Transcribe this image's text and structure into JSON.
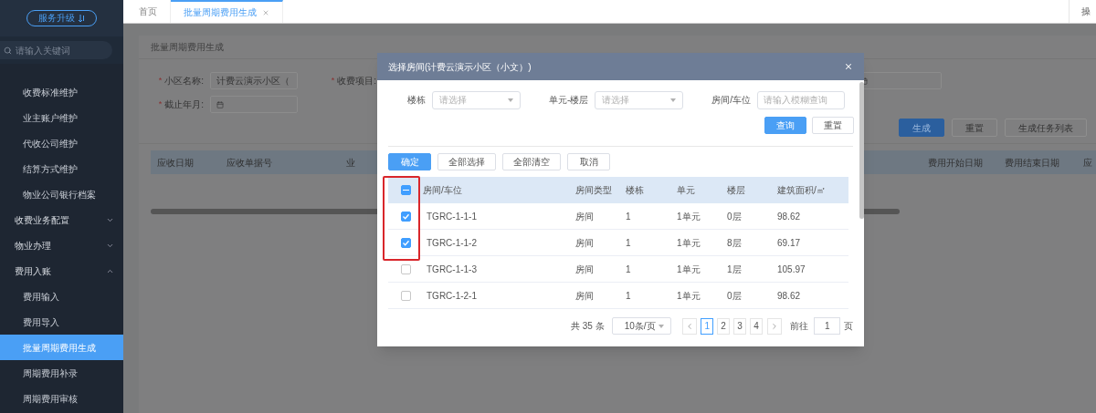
{
  "sidebar": {
    "upgrade_button": "服务升级",
    "search": {
      "placeholder": "请输入关键词"
    },
    "items": [
      {
        "label": "收费标准维护",
        "selected": false
      },
      {
        "label": "业主账户维护",
        "selected": false
      },
      {
        "label": "代收公司维护",
        "selected": false
      },
      {
        "label": "结算方式维护",
        "selected": false
      },
      {
        "label": "物业公司银行档案",
        "selected": false
      }
    ],
    "groups": [
      {
        "label": "收费业务配置",
        "expanded": false
      },
      {
        "label": "物业办理",
        "expanded": false
      },
      {
        "label": "费用入账",
        "expanded": true,
        "children": [
          {
            "label": "费用输入",
            "selected": false
          },
          {
            "label": "费用导入",
            "selected": false
          },
          {
            "label": "批量周期费用生成",
            "selected": true
          },
          {
            "label": "周期费用补录",
            "selected": false
          },
          {
            "label": "周期费用审核",
            "selected": false
          }
        ]
      }
    ]
  },
  "top_bar": {
    "tabs": [
      {
        "label": "首页",
        "selected": false,
        "closable": false
      },
      {
        "label": "批量周期费用生成",
        "selected": true,
        "closable": true
      }
    ],
    "right_label": "操"
  },
  "page": {
    "title": "批量周期费用生成",
    "form_rows": [
      [
        {
          "kind": "text",
          "required_mark": "*",
          "label": "小区名称:",
          "value": "计费云演示小区（"
        },
        {
          "kind": "label_only",
          "required_mark": "*",
          "label": "收费项目:"
        },
        {
          "kind": "date"
        }
      ],
      [
        {
          "kind": "date",
          "required_mark": "*",
          "label": "截止年月:"
        }
      ]
    ],
    "buttons": [
      {
        "label": "生成",
        "primary": true
      },
      {
        "label": "重置",
        "primary": false
      },
      {
        "label": "生成任务列表",
        "primary": false
      }
    ],
    "table": {
      "columns_left": [
        "应收日期",
        "应收单据号",
        "业"
      ],
      "columns_right": [
        "费用开始日期",
        "费用结束日期",
        "应"
      ]
    }
  },
  "modal": {
    "title": "选择房间(计费云演示小区（小文）)",
    "filters": [
      {
        "kind": "select",
        "label": "楼栋",
        "placeholder": "请选择"
      },
      {
        "kind": "select",
        "label": "单元-楼层",
        "placeholder": "请选择"
      },
      {
        "kind": "input",
        "label": "房间/车位",
        "placeholder": "请输入模糊查询"
      }
    ],
    "filter_buttons": [
      {
        "label": "查询",
        "primary": true
      },
      {
        "label": "重置",
        "primary": false
      }
    ],
    "actions": [
      {
        "label": "确定",
        "primary": true
      },
      {
        "label": "全部选择",
        "primary": false
      },
      {
        "label": "全部清空",
        "primary": false
      },
      {
        "label": "取消",
        "primary": false
      }
    ],
    "header_checked": true,
    "header_indeterminate": true,
    "columns": [
      "房间/车位",
      "房间类型",
      "楼栋",
      "单元",
      "楼层",
      "建筑面积/㎡"
    ],
    "rows": [
      {
        "checked": true,
        "cells": [
          "TGRC-1-1-1",
          "房间",
          "1",
          "1单元",
          "0层",
          "98.62"
        ]
      },
      {
        "checked": true,
        "cells": [
          "TGRC-1-1-2",
          "房间",
          "1",
          "1单元",
          "8层",
          "69.17"
        ]
      },
      {
        "checked": false,
        "cells": [
          "TGRC-1-1-3",
          "房间",
          "1",
          "1单元",
          "1层",
          "105.97"
        ]
      },
      {
        "checked": false,
        "cells": [
          "TGRC-1-2-1",
          "房间",
          "1",
          "1单元",
          "0层",
          "98.62"
        ]
      }
    ],
    "pagination": {
      "total": "共 35 条",
      "page_size": "10条/页",
      "pages": [
        {
          "label": "1",
          "selected": true
        },
        {
          "label": "2",
          "selected": false
        },
        {
          "label": "3",
          "selected": false
        },
        {
          "label": "4",
          "selected": false
        }
      ],
      "goto_label": "前往",
      "goto_value": "1",
      "page_suffix": "页"
    }
  }
}
